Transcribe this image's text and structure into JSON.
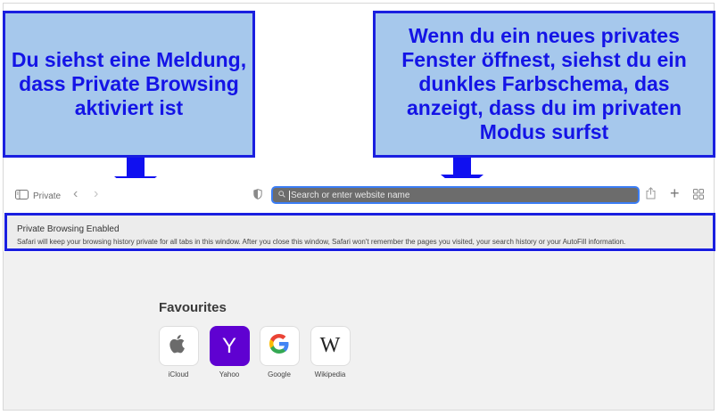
{
  "callouts": {
    "left": "Du siehst eine Meldung,\ndass Private Browsing\naktiviert ist",
    "right": "Wenn du ein neues privates\nFenster öffnest, siehst du ein\ndunkles Farbschema, das\nanzeigt, dass du im privaten\nModus surfst"
  },
  "toolbar": {
    "sidebar_label": "Private",
    "search_placeholder": "Search or enter website name"
  },
  "banner": {
    "title": "Private Browsing Enabled",
    "message": "Safari will keep your browsing history private for all tabs in this window. After you close this window, Safari won't remember the pages you visited, your search history or your AutoFill information."
  },
  "favourites": {
    "title": "Favourites",
    "items": [
      {
        "label": "iCloud",
        "icon": "apple-icon"
      },
      {
        "label": "Yahoo",
        "icon": "yahoo-icon",
        "glyph": "Y"
      },
      {
        "label": "Google",
        "icon": "google-icon"
      },
      {
        "label": "Wikipedia",
        "icon": "wikipedia-icon",
        "glyph": "W"
      }
    ]
  },
  "colors": {
    "callout_bg": "#a6c8ec",
    "callout_border": "#1a1fe0",
    "callout_text": "#1414e6",
    "address_bar_bg": "#6c6c6c",
    "yahoo_purple": "#5f01d1"
  }
}
